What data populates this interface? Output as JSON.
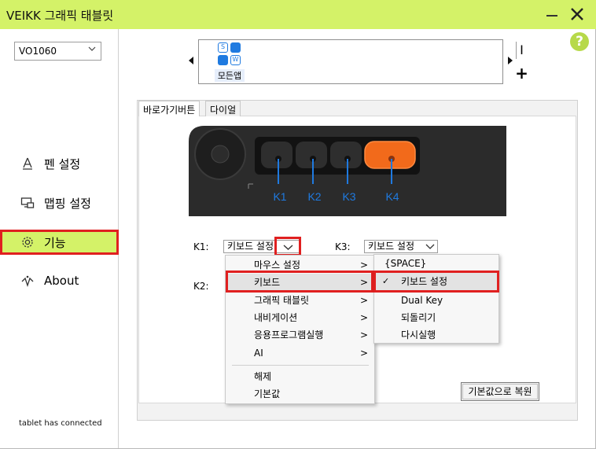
{
  "window": {
    "title": "VEIKK 그래픽 태블릿",
    "minimize": "—",
    "close": "✕"
  },
  "sidebar": {
    "device": "VO1060",
    "items": [
      {
        "label": "펜 설정"
      },
      {
        "label": "맵핑 설정"
      },
      {
        "label": "기능"
      },
      {
        "label": "About"
      }
    ],
    "status": "tablet has connected"
  },
  "help": "?",
  "appbar": {
    "apps": [
      {
        "label": "모든앱",
        "icons": [
          "S",
          "",
          "",
          "W"
        ]
      }
    ],
    "minus": "I",
    "plus": "+"
  },
  "tabs": [
    {
      "label": "바로가기버튼"
    },
    {
      "label": "다이얼"
    }
  ],
  "tablet": {
    "keys": [
      "K1",
      "K2",
      "K3",
      "K4"
    ]
  },
  "keys": {
    "k1_label": "K1:",
    "k1_value": "키보드 설정",
    "k2_label": "K2:",
    "k3_label": "K3:",
    "k3_value": "키보드 설정"
  },
  "menu": {
    "items": [
      "마우스 설정",
      "키보드",
      "그래픽 태블릿",
      "내비게이션",
      "응용프로그램실행",
      "AI"
    ],
    "items2": [
      "해제",
      "기본값"
    ]
  },
  "submenu": {
    "items": [
      "{SPACE}",
      "키보드 설정",
      "Dual Key",
      "되돌리기",
      "다시실행"
    ]
  },
  "reset_button": "기본값으로 복원",
  "colors": {
    "accent": "#d4f268",
    "highlight": "#e02020",
    "key_orange": "#f26a1b",
    "key_blue": "#1f7ae0"
  }
}
